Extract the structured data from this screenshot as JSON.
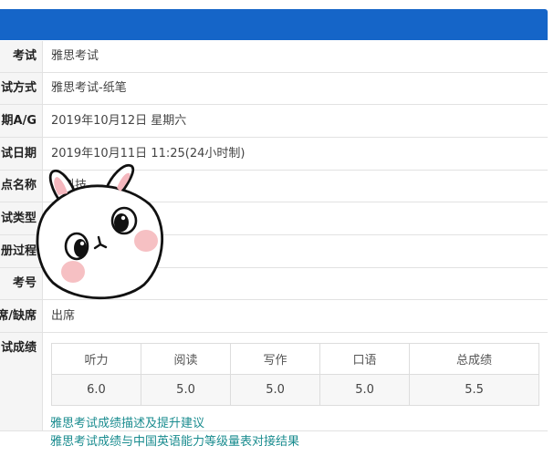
{
  "details": {
    "rows": [
      {
        "label": "考试",
        "value": "雅思考试"
      },
      {
        "label": "试方式",
        "value": "雅思考试-纸笔"
      },
      {
        "label": "期A/G",
        "value": "2019年10月12日 星期六"
      },
      {
        "label": "试日期",
        "value": "2019年10月11日 11:25(24小时制)"
      },
      {
        "label": "点名称",
        "value": "子科技"
      },
      {
        "label": "试类型",
        "value": ""
      },
      {
        "label": "册过程)",
        "value": ""
      },
      {
        "label": "考号",
        "value": ""
      },
      {
        "label": "席/缺席",
        "value": "出席"
      },
      {
        "label": "试成绩",
        "value": ""
      }
    ]
  },
  "scores": {
    "headers": [
      "听力",
      "阅读",
      "写作",
      "口语",
      "总成绩"
    ],
    "values": [
      "6.0",
      "5.0",
      "5.0",
      "5.0",
      "5.5"
    ]
  },
  "links": [
    "雅思考试成绩描述及提升建议",
    "雅思考试成绩与中国英语能力等级量表对接结果"
  ],
  "colors": {
    "header_bar": "#1565c8",
    "link": "#1a8c8f"
  }
}
